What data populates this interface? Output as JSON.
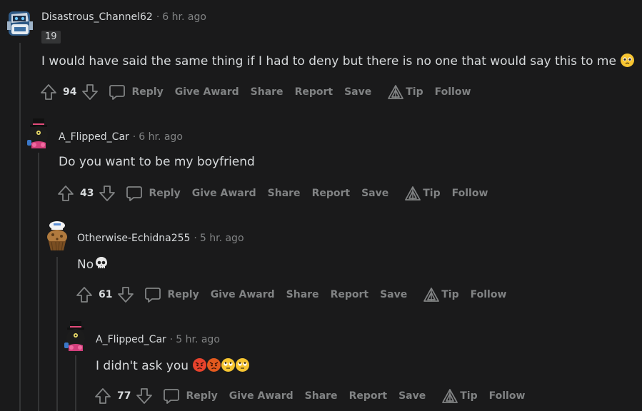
{
  "comments": [
    {
      "username": "Disastrous_Channel62",
      "time": "6 hr. ago",
      "flair": "19",
      "text": "I would have said the same thing if I had to deny but there is no one that would say this to me",
      "emojis": [
        "pleading-face-emoji"
      ],
      "score": "94",
      "avatar": "robot-avatar"
    },
    {
      "username": "A_Flipped_Car",
      "time": "6 hr. ago",
      "text": "Do you want to be my boyfriend",
      "emojis": [],
      "score": "43",
      "avatar": "top-hat-creature-avatar"
    },
    {
      "username": "Otherwise-Echidna255",
      "time": "5 hr. ago",
      "text": "No",
      "emojis": [
        "skull-emoji"
      ],
      "score": "61",
      "avatar": "chef-muffin-avatar"
    },
    {
      "username": "A_Flipped_Car",
      "time": "5 hr. ago",
      "text": "I didn't ask you",
      "emojis": [
        "pouting-face-emoji",
        "angry-face-emoji",
        "rolling-eyes-emoji",
        "rolling-eyes-emoji"
      ],
      "score": "77",
      "avatar": "top-hat-creature-avatar"
    }
  ],
  "actions": {
    "reply": "Reply",
    "give_award": "Give Award",
    "share": "Share",
    "report": "Report",
    "save": "Save",
    "tip": "Tip",
    "follow": "Follow"
  },
  "dot": "·",
  "colors": {
    "background": "#1a1a1b",
    "text": "#d7dadc",
    "muted": "#818384",
    "thread_line": "#343536"
  }
}
